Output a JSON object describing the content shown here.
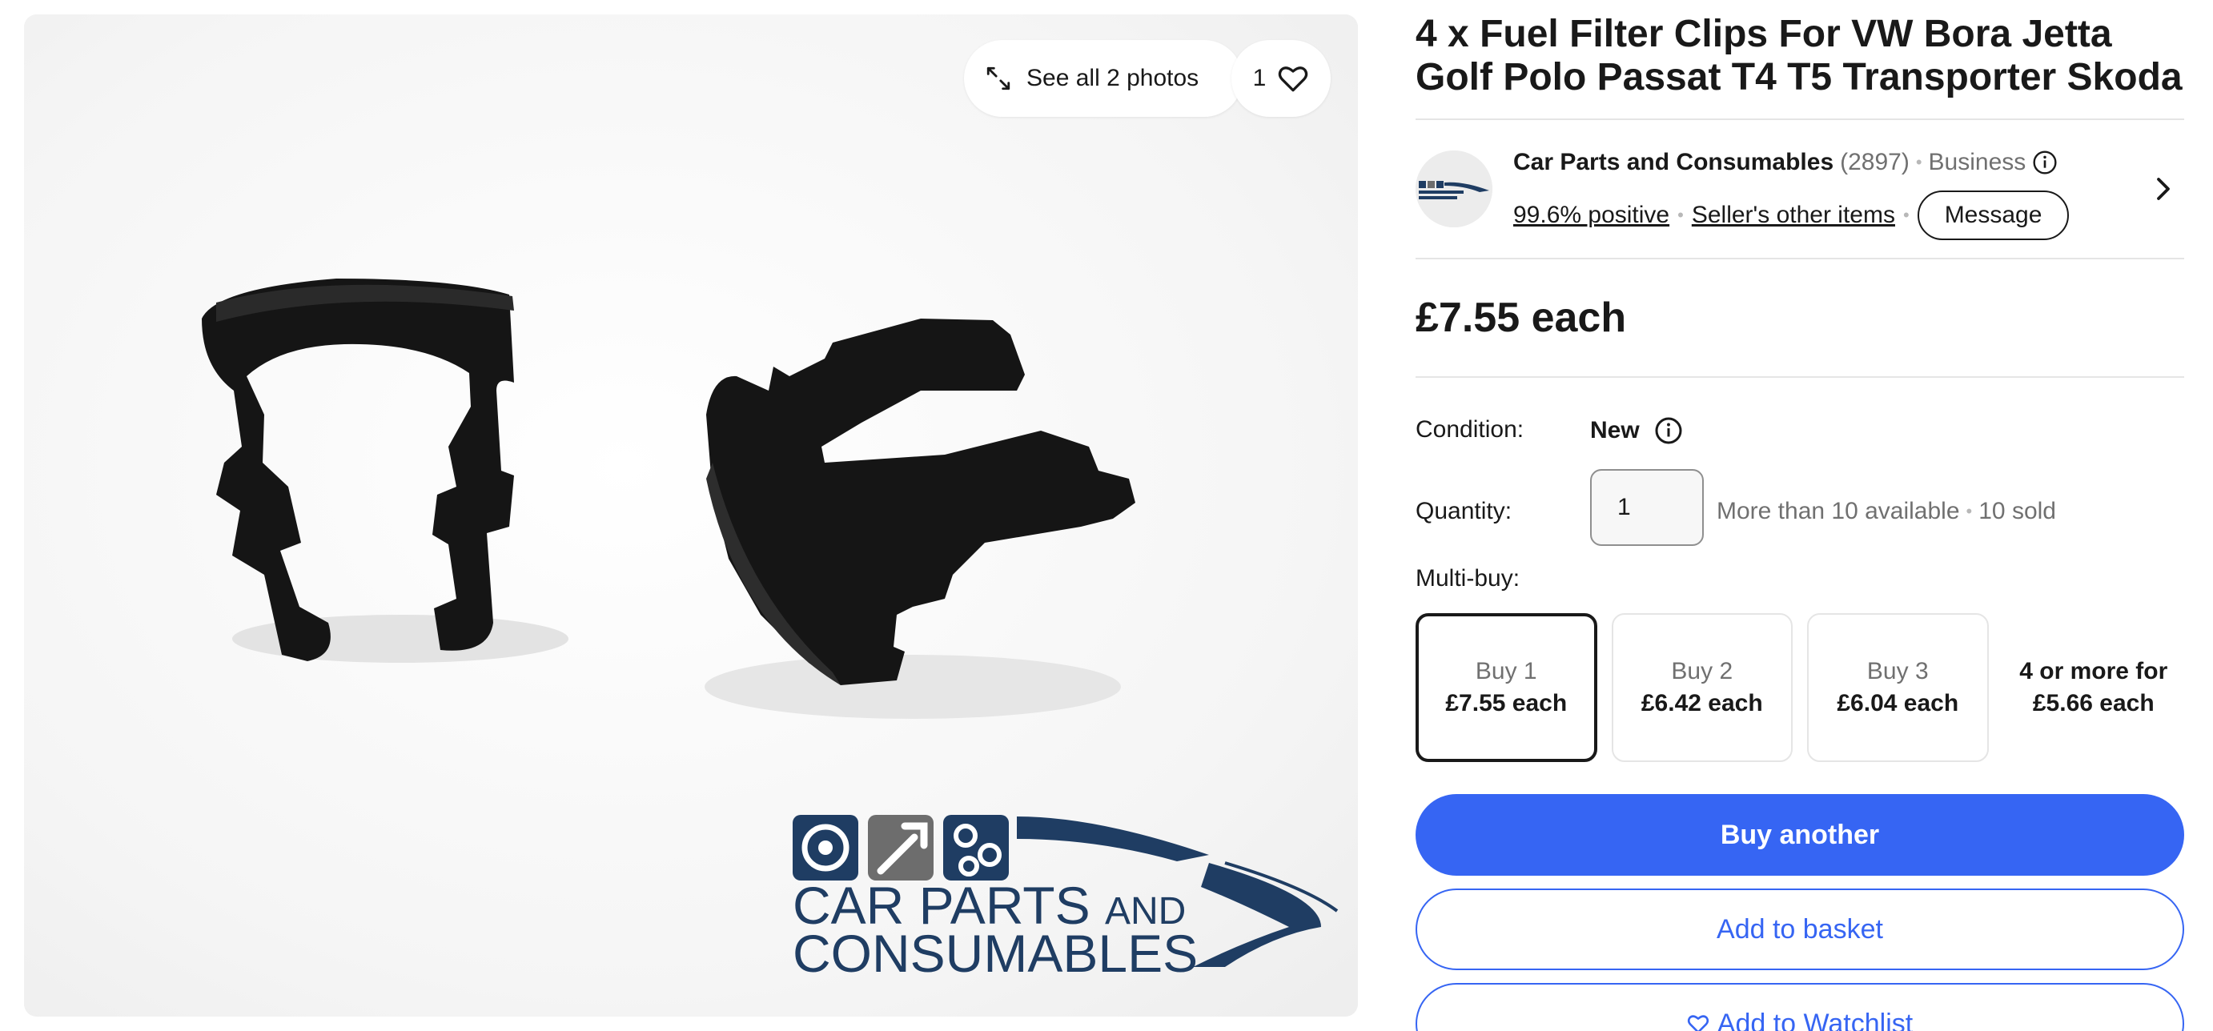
{
  "gallery": {
    "see_all_label": "See all 2 photos",
    "like_count": "1",
    "logo_text_line1": "CAR PARTS",
    "logo_text_and": "AND",
    "logo_text_line2": "CONSUMABLES"
  },
  "listing": {
    "title": "4 x Fuel Filter Clips For VW Bora Jetta Golf Polo Passat T4 T5 Transporter Skoda",
    "price": "£7.55 each"
  },
  "seller": {
    "name": "Car Parts and Consumables",
    "feedback_count": "(2897)",
    "type": "Business",
    "positive": "99.6% positive",
    "other_items": "Seller's other items",
    "message_label": "Message"
  },
  "condition": {
    "label": "Condition:",
    "value": "New"
  },
  "quantity": {
    "label": "Quantity:",
    "value": "1",
    "available": "More than 10 available",
    "sold": "10 sold"
  },
  "multibuy": {
    "label": "Multi-buy:",
    "tiers": [
      {
        "qty": "Buy 1",
        "price": "£7.55 each"
      },
      {
        "qty": "Buy 2",
        "price": "£6.42 each"
      },
      {
        "qty": "Buy 3",
        "price": "£6.04 each"
      }
    ],
    "more": "4 or more for £5.66 each"
  },
  "actions": {
    "buy_another": "Buy another",
    "add_to_basket": "Add to basket",
    "add_to_watchlist": "Add to Watchlist"
  },
  "colors": {
    "primary": "#3665f3",
    "logo_navy": "#1f3d63",
    "logo_grey": "#6d6d6d",
    "clip_black": "#151515"
  }
}
